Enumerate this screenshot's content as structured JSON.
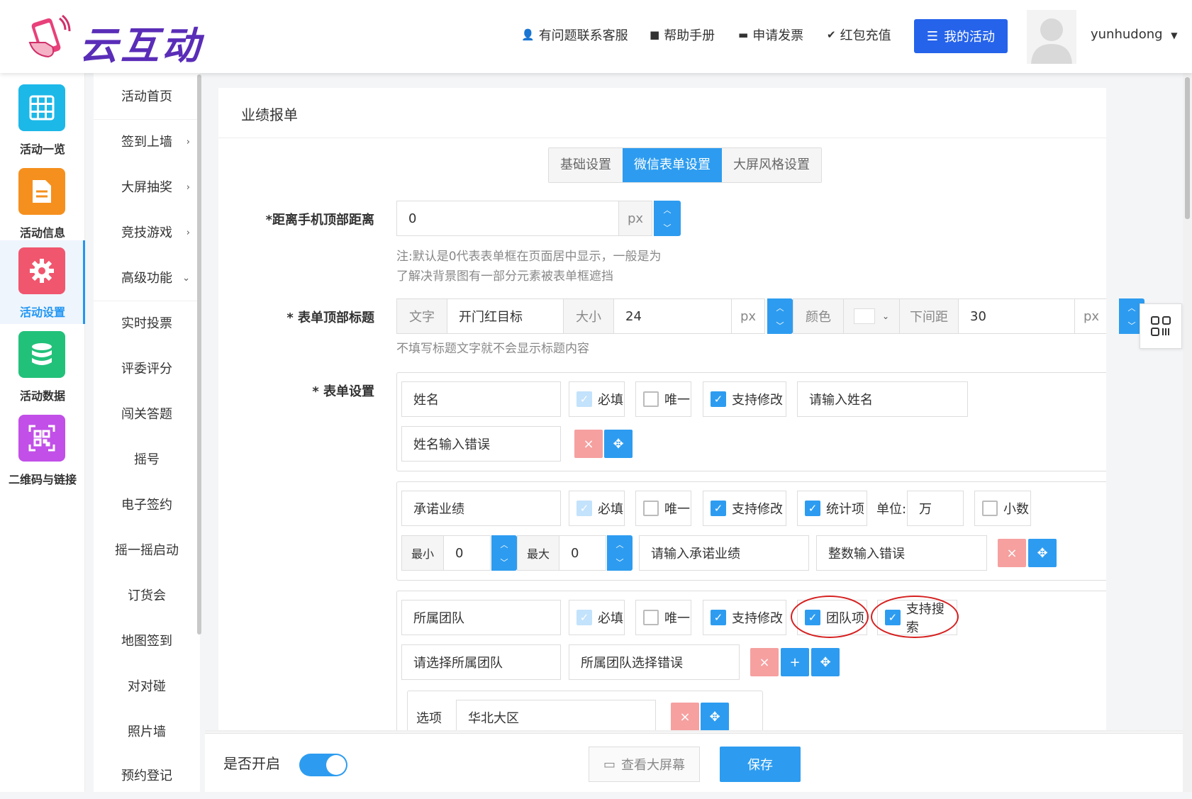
{
  "header": {
    "logo_text": "云互动",
    "nav": [
      {
        "label": "有问题联系客服",
        "icon": "user-plus-icon"
      },
      {
        "label": "帮助手册",
        "icon": "book-icon"
      },
      {
        "label": "申请发票",
        "icon": "printer-icon"
      },
      {
        "label": "红包充值",
        "icon": "shield-check-icon"
      }
    ],
    "my_activity": "我的活动",
    "username": "yunhudong"
  },
  "iconbar": [
    {
      "label": "活动一览",
      "color": "#1cb8e8",
      "icon": "grid-icon"
    },
    {
      "label": "活动信息",
      "color": "#f5901e",
      "icon": "document-icon"
    },
    {
      "label": "活动设置",
      "color": "#f0566e",
      "icon": "gear-icon"
    },
    {
      "label": "活动数据",
      "color": "#22c17a",
      "icon": "database-icon"
    },
    {
      "label": "二维码与链接",
      "color": "#c24fe8",
      "icon": "qrcode-icon"
    }
  ],
  "submenu": [
    {
      "label": "活动首页",
      "chev": ""
    },
    {
      "label": "签到上墙",
      "chev": "›"
    },
    {
      "label": "大屏抽奖",
      "chev": "›"
    },
    {
      "label": "竞技游戏",
      "chev": "›"
    },
    {
      "label": "高级功能",
      "chev": "⌄"
    },
    {
      "label": "实时投票",
      "chev": ""
    },
    {
      "label": "评委评分",
      "chev": ""
    },
    {
      "label": "闯关答题",
      "chev": ""
    },
    {
      "label": "摇号",
      "chev": ""
    },
    {
      "label": "电子签约",
      "chev": ""
    },
    {
      "label": "摇一摇启动",
      "chev": ""
    },
    {
      "label": "订货会",
      "chev": ""
    },
    {
      "label": "地图签到",
      "chev": ""
    },
    {
      "label": "对对碰",
      "chev": ""
    },
    {
      "label": "照片墙",
      "chev": ""
    },
    {
      "label": "预约登记",
      "chev": ""
    }
  ],
  "main": {
    "title": "业绩报单",
    "tabs": [
      "基础设置",
      "微信表单设置",
      "大屏风格设置"
    ],
    "top_distance": {
      "label": "*距离手机顶部距离",
      "value": "0",
      "unit": "px",
      "note1": "注:默认是0代表表单框在页面居中显示，一般是为",
      "note2": "了解决背景图有一部分元素被表单框遮挡"
    },
    "form_title": {
      "label": "* 表单顶部标题",
      "text_addon": "文字",
      "text_value": "开门红目标",
      "size_addon": "大小",
      "size_value": "24",
      "unit": "px",
      "color_addon": "颜色",
      "spacing_addon": "下间距",
      "spacing_value": "30",
      "note": "不填写标题文字就不会显示标题内容"
    },
    "form_settings_label": "* 表单设置",
    "fields": {
      "name": {
        "value": "姓名",
        "required": "必填",
        "unique": "唯一",
        "editable": "支持修改",
        "placeholder": "请输入姓名",
        "error": "姓名输入错误"
      },
      "promise": {
        "value": "承诺业绩",
        "required": "必填",
        "unique": "唯一",
        "editable": "支持修改",
        "stat": "统计项",
        "unit_label": "单位:",
        "unit_value": "万",
        "decimal": "小数",
        "min_label": "最小",
        "min_value": "0",
        "max_label": "最大",
        "max_value": "0",
        "placeholder": "请输入承诺业绩",
        "error": "整数输入错误"
      },
      "team": {
        "value": "所属团队",
        "required": "必填",
        "unique": "唯一",
        "editable": "支持修改",
        "team_item": "团队项",
        "searchable": "支持搜索",
        "placeholder": "请选择所属团队",
        "error": "所属团队选择错误",
        "option_label": "选项",
        "option_value": "华北大区"
      }
    }
  },
  "bottom": {
    "toggle_label": "是否开启",
    "view_screen": "查看大屏幕",
    "save": "保存"
  }
}
